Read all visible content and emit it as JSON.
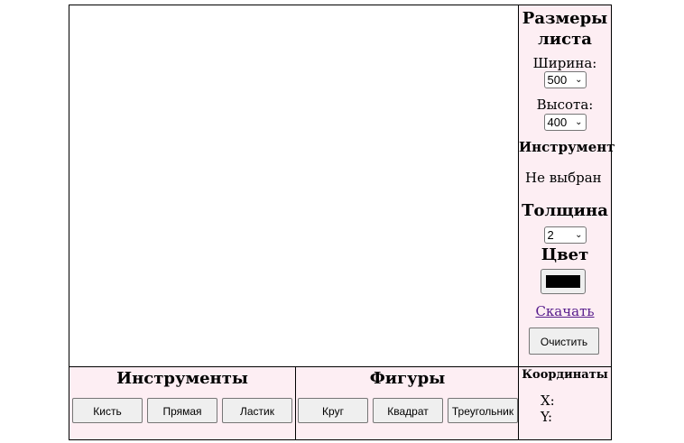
{
  "sheet_size": {
    "title": "Размеры листа",
    "width_label": "Ширина:",
    "width_value": "500",
    "height_label": "Высота:",
    "height_value": "400"
  },
  "tool": {
    "title": "Инструмент",
    "current": "Не выбран"
  },
  "thickness": {
    "title": "Толщина",
    "value": "2"
  },
  "color": {
    "title": "Цвет",
    "value": "#000000"
  },
  "actions": {
    "download_label": "Скачать",
    "clear_label": "Очистить"
  },
  "instruments": {
    "title": "Инструменты",
    "buttons": [
      "Кисть",
      "Прямая",
      "Ластик"
    ]
  },
  "figures": {
    "title": "Фигуры",
    "buttons": [
      "Круг",
      "Квадрат",
      "Треугольник"
    ]
  },
  "coordinates": {
    "title": "Координаты",
    "x_label": "X:",
    "y_label": "Y:"
  }
}
